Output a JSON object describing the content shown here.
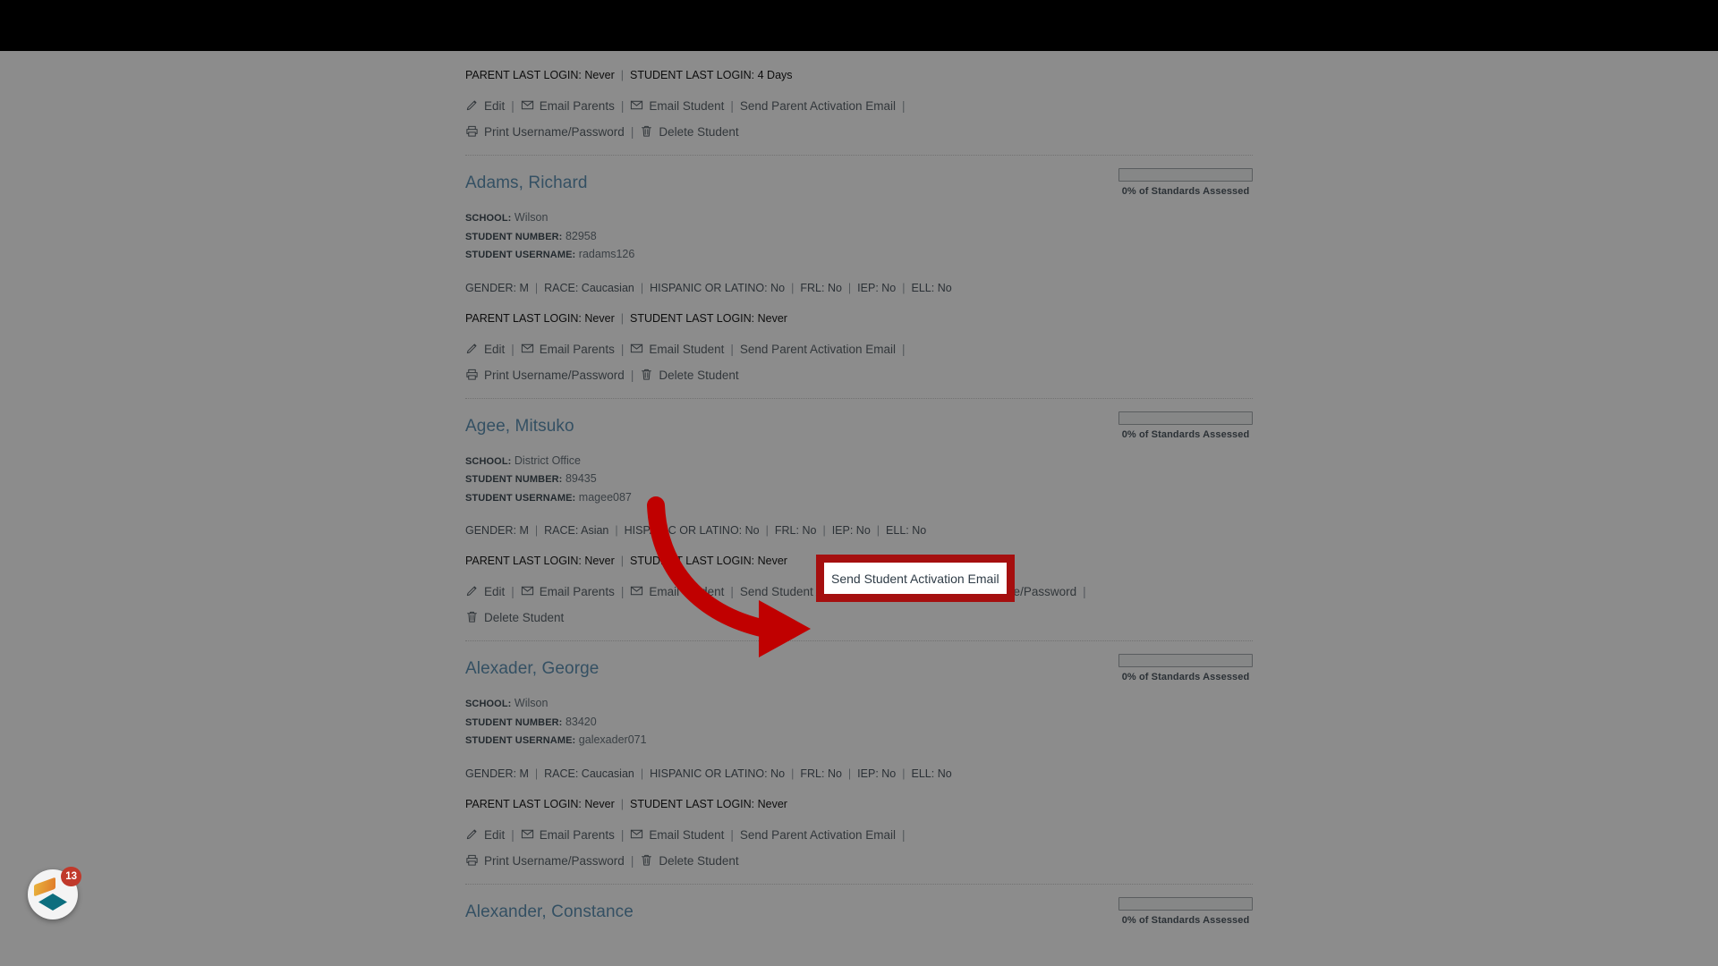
{
  "app": {
    "highlight_color": "#a50f0f",
    "link_color": "#4f87ad",
    "arrow_color": "#c00000"
  },
  "fab": {
    "badge_count": "13",
    "name": "notifications-badge"
  },
  "labels": {
    "school": "SCHOOL:",
    "student_number": "STUDENT NUMBER:",
    "student_username": "STUDENT USERNAME:",
    "gender": "GENDER:",
    "race": "RACE:",
    "hispanic": "HISPANIC OR LATINO:",
    "frl": "FRL:",
    "iep": "IEP:",
    "ell": "ELL:",
    "parent_last_login": "PARENT LAST LOGIN:",
    "student_last_login": "STUDENT LAST LOGIN:",
    "progress": "0% of Standards Assessed",
    "sep": "|"
  },
  "actions": {
    "edit": "Edit",
    "email_parents": "Email Parents",
    "email_student": "Email Student",
    "send_parent_activation": "Send Parent Activation Email",
    "send_student_activation": "Send Student Activation Email",
    "print_credentials": "Print Username/Password",
    "delete_student": "Delete Student"
  },
  "highlight": {
    "tooltip_text": "Send Student Activation Email"
  },
  "partial_top_record": {
    "parent_last_login": "Never",
    "student_last_login": "4 Days"
  },
  "students": [
    {
      "name": "Adams, Richard",
      "school": "Wilson",
      "student_number": "82958",
      "student_username": "radams126",
      "gender": "M",
      "race": "Caucasian",
      "hispanic": "No",
      "frl": "No",
      "iep": "No",
      "ell": "No",
      "parent_last_login": "Never",
      "student_last_login": "Never",
      "progress": "0% of Standards Assessed"
    },
    {
      "name": "Agee, Mitsuko",
      "school": "District Office",
      "student_number": "89435",
      "student_username": "magee087",
      "gender": "M",
      "race": "Asian",
      "hispanic": "No",
      "frl": "No",
      "iep": "No",
      "ell": "No",
      "parent_last_login": "Never",
      "student_last_login": "Never",
      "progress": "0% of Standards Assessed"
    },
    {
      "name": "Alexader, George",
      "school": "Wilson",
      "student_number": "83420",
      "student_username": "galexader071",
      "gender": "M",
      "race": "Caucasian",
      "hispanic": "No",
      "frl": "No",
      "iep": "No",
      "ell": "No",
      "parent_last_login": "Never",
      "student_last_login": "Never",
      "progress": "0% of Standards Assessed"
    },
    {
      "name": "Alexander, Constance",
      "school": "",
      "student_number": "",
      "student_username": "",
      "gender": "",
      "race": "",
      "hispanic": "",
      "frl": "",
      "iep": "",
      "ell": "",
      "parent_last_login": "",
      "student_last_login": "",
      "progress": "0% of Standards Assessed"
    }
  ]
}
